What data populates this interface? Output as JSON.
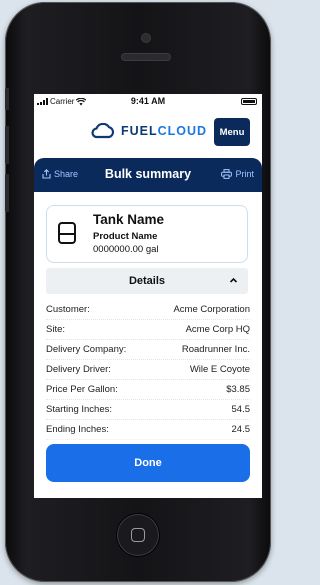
{
  "status_bar": {
    "carrier": "Carrier",
    "time": "9:41 AM"
  },
  "header": {
    "brand_part1": "FUEL",
    "brand_part2": "CLOUD",
    "menu_label": "Menu"
  },
  "toolbar": {
    "share_label": "Share",
    "title": "Bulk summary",
    "print_label": "Print"
  },
  "tank": {
    "name": "Tank Name",
    "product": "Product Name",
    "volume": "0000000.00 gal"
  },
  "details": {
    "label": "Details",
    "rows": [
      {
        "label": "Customer:",
        "value": "Acme Corporation"
      },
      {
        "label": "Site:",
        "value": "Acme Corp HQ"
      },
      {
        "label": "Delivery Company:",
        "value": "Roadrunner Inc."
      },
      {
        "label": "Delivery Driver:",
        "value": "Wile E Coyote"
      },
      {
        "label": "Price Per Gallon:",
        "value": "$3.85"
      },
      {
        "label": "Starting Inches:",
        "value": "54.5"
      },
      {
        "label": "Ending Inches:",
        "value": "24.5"
      }
    ]
  },
  "actions": {
    "done_label": "Done"
  },
  "icons": {
    "logo": "cloud-logo-icon",
    "share": "share-icon",
    "print": "printer-icon",
    "tank": "tank-icon",
    "chevron": "chevron-up-icon"
  },
  "colors": {
    "navy": "#0b2a5c",
    "accent": "#1a6ee8",
    "brand_blue": "#1c78e0"
  }
}
